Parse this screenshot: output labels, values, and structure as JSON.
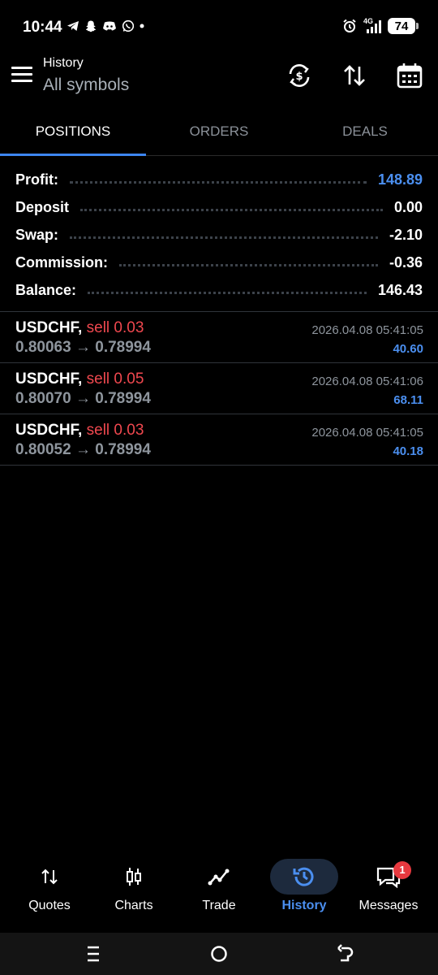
{
  "status_bar": {
    "time": "10:44",
    "network": "4G",
    "battery": "74"
  },
  "header": {
    "title": "History",
    "subtitle": "All symbols"
  },
  "tabs": [
    {
      "label": "POSITIONS",
      "active": true
    },
    {
      "label": "ORDERS",
      "active": false
    },
    {
      "label": "DEALS",
      "active": false
    }
  ],
  "summary": [
    {
      "label": "Profit:",
      "value": "148.89"
    },
    {
      "label": "Deposit",
      "value": "0.00"
    },
    {
      "label": "Swap:",
      "value": "-2.10"
    },
    {
      "label": "Commission:",
      "value": "-0.36"
    },
    {
      "label": "Balance:",
      "value": "146.43"
    }
  ],
  "positions": [
    {
      "symbol": "USDCHF,",
      "type": "sell 0.03",
      "open": "0.80063",
      "arrow": "→",
      "close": "0.78994",
      "time": "2026.04.08 05:41:05",
      "profit": "40.60"
    },
    {
      "symbol": "USDCHF,",
      "type": "sell 0.05",
      "open": "0.80070",
      "arrow": "→",
      "close": "0.78994",
      "time": "2026.04.08 05:41:06",
      "profit": "68.11"
    },
    {
      "symbol": "USDCHF,",
      "type": "sell 0.03",
      "open": "0.80052",
      "arrow": "→",
      "close": "0.78994",
      "time": "2026.04.08 05:41:05",
      "profit": "40.18"
    }
  ],
  "bottom_nav": [
    {
      "label": "Quotes",
      "icon": "quotes-icon"
    },
    {
      "label": "Charts",
      "icon": "charts-icon"
    },
    {
      "label": "Trade",
      "icon": "trade-icon"
    },
    {
      "label": "History",
      "icon": "history-icon",
      "active": true
    },
    {
      "label": "Messages",
      "icon": "messages-icon",
      "badge": "1"
    }
  ],
  "colors": {
    "accent": "#3d86f0",
    "sell": "#f0484f",
    "muted": "#8e959d",
    "background": "#000000"
  }
}
